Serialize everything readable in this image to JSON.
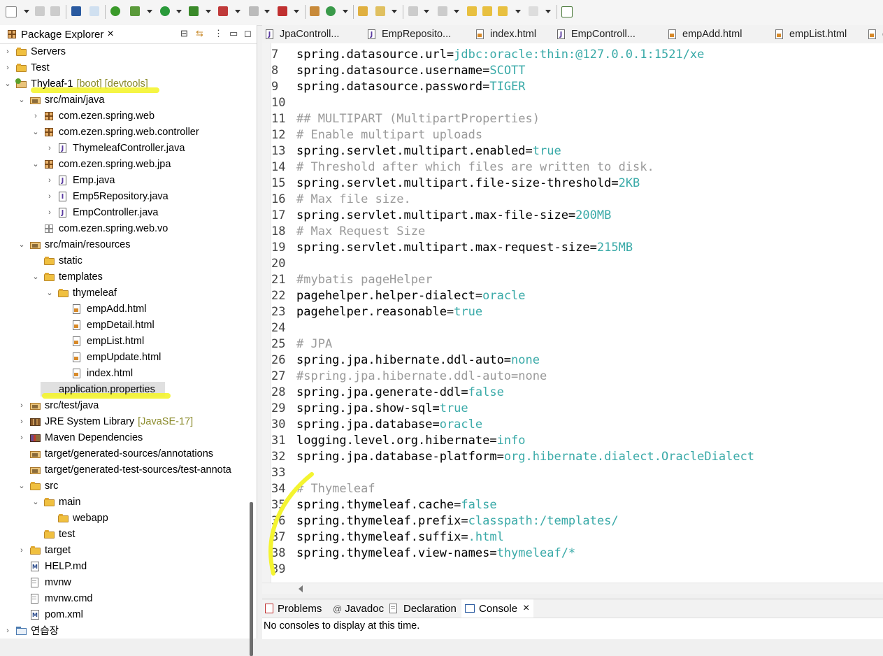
{
  "explorer": {
    "title": "Package Explorer",
    "close_symbol": "×",
    "items": [
      {
        "label": "Servers",
        "deco": ""
      },
      {
        "label": "Test",
        "deco": ""
      },
      {
        "label": "Thyleaf-1",
        "deco": "[boot] [devtools]"
      },
      {
        "label": "src/main/java",
        "deco": ""
      },
      {
        "label": "com.ezen.spring.web",
        "deco": ""
      },
      {
        "label": "com.ezen.spring.web.controller",
        "deco": ""
      },
      {
        "label": "ThymeleafController.java",
        "deco": ""
      },
      {
        "label": "com.ezen.spring.web.jpa",
        "deco": ""
      },
      {
        "label": "Emp.java",
        "deco": ""
      },
      {
        "label": "Emp5Repository.java",
        "deco": ""
      },
      {
        "label": "EmpController.java",
        "deco": ""
      },
      {
        "label": "com.ezen.spring.web.vo",
        "deco": ""
      },
      {
        "label": "src/main/resources",
        "deco": ""
      },
      {
        "label": "static",
        "deco": ""
      },
      {
        "label": "templates",
        "deco": ""
      },
      {
        "label": "thymeleaf",
        "deco": ""
      },
      {
        "label": "empAdd.html",
        "deco": ""
      },
      {
        "label": "empDetail.html",
        "deco": ""
      },
      {
        "label": "empList.html",
        "deco": ""
      },
      {
        "label": "empUpdate.html",
        "deco": ""
      },
      {
        "label": "index.html",
        "deco": ""
      },
      {
        "label": "application.properties",
        "deco": ""
      },
      {
        "label": "src/test/java",
        "deco": ""
      },
      {
        "label": "JRE System Library",
        "deco": "[JavaSE-17]"
      },
      {
        "label": "Maven Dependencies",
        "deco": ""
      },
      {
        "label": "target/generated-sources/annotations",
        "deco": ""
      },
      {
        "label": "target/generated-test-sources/test-annota",
        "deco": ""
      },
      {
        "label": "src",
        "deco": ""
      },
      {
        "label": "main",
        "deco": ""
      },
      {
        "label": "webapp",
        "deco": ""
      },
      {
        "label": "test",
        "deco": ""
      },
      {
        "label": "target",
        "deco": ""
      },
      {
        "label": "HELP.md",
        "deco": ""
      },
      {
        "label": "mvnw",
        "deco": ""
      },
      {
        "label": "mvnw.cmd",
        "deco": ""
      },
      {
        "label": "pom.xml",
        "deco": ""
      },
      {
        "label": "연습장",
        "deco": ""
      }
    ]
  },
  "editor": {
    "tabs": [
      "JpaControll...",
      "EmpReposito...",
      "index.html",
      "EmpControll...",
      "empAdd.html",
      "empList.html",
      "em"
    ],
    "lines": [
      {
        "n": "7",
        "key": "spring.datasource.url=",
        "val": "jdbc:oracle:thin:@127.0.0.1:1521/xe"
      },
      {
        "n": "8",
        "key": "spring.datasource.username=",
        "val": "SCOTT"
      },
      {
        "n": "9",
        "key": "spring.datasource.password=",
        "val": "TIGER"
      },
      {
        "n": "10",
        "key": "",
        "val": ""
      },
      {
        "n": "11",
        "comment": "## MULTIPART (MultipartProperties)"
      },
      {
        "n": "12",
        "comment": "# Enable multipart uploads"
      },
      {
        "n": "13",
        "key": "spring.servlet.multipart.enabled=",
        "val": "true"
      },
      {
        "n": "14",
        "comment": "# Threshold after which files are written to disk."
      },
      {
        "n": "15",
        "key": "spring.servlet.multipart.file-size-threshold=",
        "val": "2KB"
      },
      {
        "n": "16",
        "comment": "# Max file size."
      },
      {
        "n": "17",
        "key": "spring.servlet.multipart.max-file-size=",
        "val": "200MB"
      },
      {
        "n": "18",
        "comment": "# Max Request Size"
      },
      {
        "n": "19",
        "key": "spring.servlet.multipart.max-request-size=",
        "val": "215MB"
      },
      {
        "n": "20",
        "key": "",
        "val": ""
      },
      {
        "n": "21",
        "comment": "#mybatis pageHelper"
      },
      {
        "n": "22",
        "key": "pagehelper.helper-dialect=",
        "val": "oracle"
      },
      {
        "n": "23",
        "key": "pagehelper.reasonable=",
        "val": "true"
      },
      {
        "n": "24",
        "key": "",
        "val": ""
      },
      {
        "n": "25",
        "comment": "# JPA"
      },
      {
        "n": "26",
        "key": "spring.jpa.hibernate.ddl-auto=",
        "val": "none"
      },
      {
        "n": "27",
        "comment": "#spring.jpa.hibernate.ddl-auto=none"
      },
      {
        "n": "28",
        "key": "spring.jpa.generate-ddl=",
        "val": "false"
      },
      {
        "n": "29",
        "key": "spring.jpa.show-sql=",
        "val": "true"
      },
      {
        "n": "30",
        "key": "spring.jpa.database=",
        "val": "oracle"
      },
      {
        "n": "31",
        "key": "logging.level.org.hibernate=",
        "val": "info"
      },
      {
        "n": "32",
        "key": "spring.jpa.database-platform=",
        "val": "org.hibernate.dialect.OracleDialect"
      },
      {
        "n": "33",
        "key": "",
        "val": ""
      },
      {
        "n": "34",
        "comment": "# Thymeleaf"
      },
      {
        "n": "35",
        "key": "spring.thymeleaf.cache=",
        "val": "false"
      },
      {
        "n": "36",
        "key": "spring.thymeleaf.prefix=",
        "val": "classpath:/templates/"
      },
      {
        "n": "37",
        "key": "spring.thymeleaf.suffix=",
        "val": ".html"
      },
      {
        "n": "38",
        "key": "spring.thymeleaf.view-names=",
        "val": "thymeleaf/*"
      },
      {
        "n": "39",
        "key": "",
        "val": ""
      }
    ]
  },
  "bottom": {
    "tabs": [
      "Problems",
      "Javadoc",
      "Declaration",
      "Console"
    ],
    "at_symbol": "@",
    "close_symbol": "×",
    "console_message": "No consoles to display at this time."
  },
  "colors": {
    "highlight": "#f4f430",
    "value": "#3aaaa8",
    "comment": "#9a9a9a"
  }
}
